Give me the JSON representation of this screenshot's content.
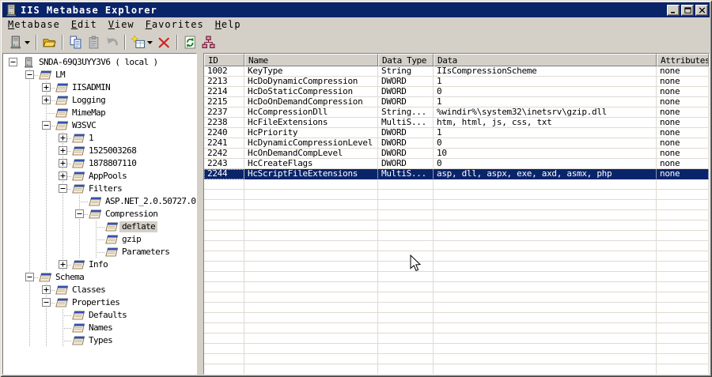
{
  "window": {
    "title": "IIS Metabase Explorer",
    "icon": "server-icon",
    "controls": [
      {
        "name": "minimize-button",
        "icon": "minimize-icon"
      },
      {
        "name": "maximize-button",
        "icon": "maximize-icon"
      },
      {
        "name": "close-button",
        "icon": "close-icon"
      }
    ]
  },
  "menu": {
    "items": [
      {
        "label": "Metabase"
      },
      {
        "label": "Edit"
      },
      {
        "label": "View"
      },
      {
        "label": "Favorites"
      },
      {
        "label": "Help"
      }
    ]
  },
  "toolbar": {
    "items": [
      {
        "kind": "button",
        "name": "connect-server",
        "icon": "server-icon",
        "dropdown": true,
        "enabled": true
      },
      {
        "kind": "separator"
      },
      {
        "kind": "button",
        "name": "open",
        "icon": "open-folder-icon",
        "enabled": true
      },
      {
        "kind": "separator"
      },
      {
        "kind": "button",
        "name": "copy",
        "icon": "copy-icon",
        "enabled": true
      },
      {
        "kind": "button",
        "name": "paste",
        "icon": "paste-icon",
        "enabled": false
      },
      {
        "kind": "button",
        "name": "undo",
        "icon": "undo-icon",
        "enabled": false
      },
      {
        "kind": "separator"
      },
      {
        "kind": "button",
        "name": "new-key",
        "icon": "new-key-icon",
        "dropdown": true,
        "enabled": true
      },
      {
        "kind": "button",
        "name": "delete",
        "icon": "delete-icon",
        "enabled": true
      },
      {
        "kind": "separator"
      },
      {
        "kind": "button",
        "name": "refresh",
        "icon": "refresh-icon",
        "enabled": true
      },
      {
        "kind": "button",
        "name": "hierarchy",
        "icon": "hierarchy-icon",
        "enabled": true
      }
    ]
  },
  "tree": {
    "items": [
      {
        "label": "SNDA-69Q3UYY3V6 ( local )",
        "level": 0,
        "expander": "minus",
        "icon": "server-icon"
      },
      {
        "label": "LM",
        "level": 1,
        "expander": "minus",
        "icon": "metabase-key-icon"
      },
      {
        "label": "IISADMIN",
        "level": 2,
        "expander": "plus",
        "icon": "metabase-key-icon"
      },
      {
        "label": "Logging",
        "level": 2,
        "expander": "plus",
        "icon": "metabase-key-icon"
      },
      {
        "label": "MimeMap",
        "level": 2,
        "expander": "none",
        "icon": "metabase-key-icon"
      },
      {
        "label": "W3SVC",
        "level": 2,
        "expander": "minus",
        "icon": "metabase-key-icon"
      },
      {
        "label": "1",
        "level": 3,
        "expander": "plus",
        "icon": "metabase-key-icon"
      },
      {
        "label": "1525003268",
        "level": 3,
        "expander": "plus",
        "icon": "metabase-key-icon"
      },
      {
        "label": "1878807110",
        "level": 3,
        "expander": "plus",
        "icon": "metabase-key-icon"
      },
      {
        "label": "AppPools",
        "level": 3,
        "expander": "plus",
        "icon": "metabase-key-icon"
      },
      {
        "label": "Filters",
        "level": 3,
        "expander": "minus",
        "icon": "metabase-key-icon"
      },
      {
        "label": "ASP.NET_2.0.50727.0",
        "level": 4,
        "expander": "none",
        "icon": "metabase-key-icon"
      },
      {
        "label": "Compression",
        "level": 4,
        "expander": "minus",
        "icon": "metabase-key-icon"
      },
      {
        "label": "deflate",
        "level": 5,
        "expander": "none",
        "icon": "metabase-key-icon",
        "selected": true
      },
      {
        "label": "gzip",
        "level": 5,
        "expander": "none",
        "icon": "metabase-key-icon"
      },
      {
        "label": "Parameters",
        "level": 5,
        "expander": "none",
        "icon": "metabase-key-icon"
      },
      {
        "label": "Info",
        "level": 3,
        "expander": "plus",
        "icon": "metabase-key-icon"
      },
      {
        "label": "Schema",
        "level": 1,
        "expander": "minus",
        "icon": "metabase-key-icon"
      },
      {
        "label": "Classes",
        "level": 2,
        "expander": "plus",
        "icon": "metabase-key-icon"
      },
      {
        "label": "Properties",
        "level": 2,
        "expander": "minus",
        "icon": "metabase-key-icon"
      },
      {
        "label": "Defaults",
        "level": 3,
        "expander": "none",
        "icon": "metabase-key-icon"
      },
      {
        "label": "Names",
        "level": 3,
        "expander": "none",
        "icon": "metabase-key-icon"
      },
      {
        "label": "Types",
        "level": 3,
        "expander": "none",
        "icon": "metabase-key-icon"
      }
    ]
  },
  "list": {
    "columns": [
      "ID",
      "Name",
      "Data Type",
      "Data",
      "Attributes"
    ],
    "rows": [
      [
        "1002",
        "KeyType",
        "String",
        "IIsCompressionScheme",
        "none"
      ],
      [
        "2213",
        "HcDoDynamicCompression",
        "DWORD",
        "1",
        "none"
      ],
      [
        "2214",
        "HcDoStaticCompression",
        "DWORD",
        "0",
        "none"
      ],
      [
        "2215",
        "HcDoOnDemandCompression",
        "DWORD",
        "1",
        "none"
      ],
      [
        "2237",
        "HcCompressionDll",
        "String...",
        "%windir%\\system32\\inetsrv\\gzip.dll",
        "none"
      ],
      [
        "2238",
        "HcFileExtensions",
        "MultiS...",
        "htm, html, js, css, txt",
        "none"
      ],
      [
        "2240",
        "HcPriority",
        "DWORD",
        "1",
        "none"
      ],
      [
        "2241",
        "HcDynamicCompressionLevel",
        "DWORD",
        "0",
        "none"
      ],
      [
        "2242",
        "HcOnDemandCompLevel",
        "DWORD",
        "10",
        "none"
      ],
      [
        "2243",
        "HcCreateFlags",
        "DWORD",
        "0",
        "none"
      ],
      [
        "2244",
        "HcScriptFileExtensions",
        "MultiS...",
        "asp, dll, aspx, exe, axd, asmx, php",
        "none"
      ]
    ],
    "selected_row_index": 10
  },
  "colors": {
    "title_bar": "#0A246A",
    "selection": "#0A246A",
    "chrome": "#D4D0C8",
    "grid_line": "#DFDAD2",
    "delete_red": "#CC2020",
    "refresh_green": "#108010"
  }
}
